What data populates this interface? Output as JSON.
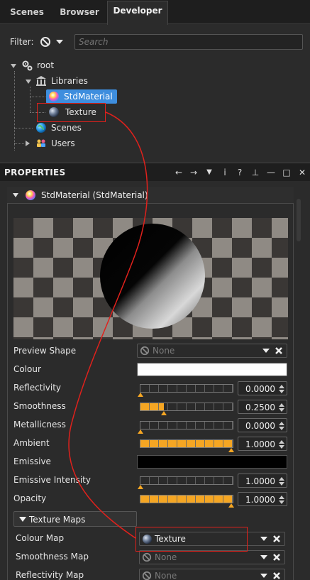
{
  "tabs": [
    "Scenes",
    "Browser",
    "Developer"
  ],
  "filter": {
    "label": "Filter:",
    "search_placeholder": "Search"
  },
  "tree": {
    "root": "root",
    "libraries": "Libraries",
    "std_material": "StdMaterial",
    "texture": "Texture",
    "scenes": "Scenes",
    "users": "Users"
  },
  "properties": {
    "title": "PROPERTIES",
    "header_buttons": [
      "←",
      "→",
      "▼",
      "i",
      "?",
      "⊥",
      "—",
      "□",
      "✕"
    ]
  },
  "material": {
    "title": "StdMaterial (StdMaterial)",
    "rows": {
      "preview_shape": {
        "label": "Preview Shape",
        "value": "None"
      },
      "colour": {
        "label": "Colour",
        "color": "#ffffff"
      },
      "reflectivity": {
        "label": "Reflectivity",
        "value": "0.0000",
        "fraction": 0.0
      },
      "smoothness": {
        "label": "Smoothness",
        "value": "0.2500",
        "fraction": 0.25
      },
      "metallicness": {
        "label": "Metallicness",
        "value": "0.0000",
        "fraction": 0.0
      },
      "ambient": {
        "label": "Ambient",
        "value": "1.0000",
        "fraction": 1.0
      },
      "emissive": {
        "label": "Emissive",
        "color": "#000000"
      },
      "emissive_intensity": {
        "label": "Emissive Intensity",
        "value": "1.0000",
        "fraction": 0.0
      },
      "opacity": {
        "label": "Opacity",
        "value": "1.0000",
        "fraction": 1.0
      }
    },
    "texture_maps": {
      "label": "Texture Maps",
      "colour_map": {
        "label": "Colour Map",
        "value": "Texture"
      },
      "smoothness_map": {
        "label": "Smoothness Map",
        "value": "None"
      },
      "reflectivity_map": {
        "label": "Reflectivity Map",
        "value": "None"
      }
    }
  },
  "colors": {
    "accent": "#f5a623",
    "selection": "#3e8ede",
    "annotation": "#e0211c"
  }
}
